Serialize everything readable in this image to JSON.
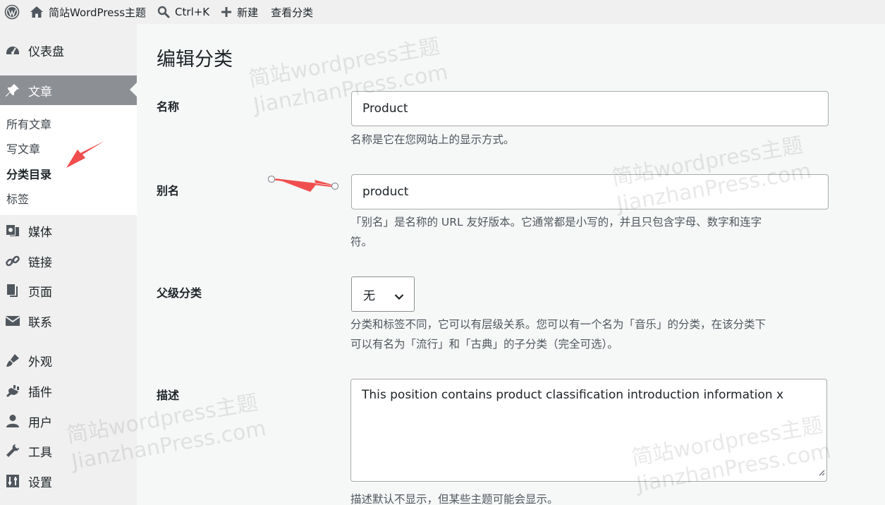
{
  "adminbar": {
    "site_name": "简站WordPress主题",
    "search_shortcut": "Ctrl+K",
    "new_label": "新建",
    "view_category": "查看分类"
  },
  "sidebar": {
    "items": [
      {
        "label": "仪表盘",
        "icon": "dashboard-icon"
      },
      {
        "label": "文章",
        "icon": "pin-icon"
      },
      {
        "label": "媒体",
        "icon": "media-icon"
      },
      {
        "label": "链接",
        "icon": "link-icon"
      },
      {
        "label": "页面",
        "icon": "page-icon"
      },
      {
        "label": "联系",
        "icon": "mail-icon"
      },
      {
        "label": "外观",
        "icon": "brush-icon"
      },
      {
        "label": "插件",
        "icon": "plugin-icon"
      },
      {
        "label": "用户",
        "icon": "user-icon"
      },
      {
        "label": "工具",
        "icon": "wrench-icon"
      },
      {
        "label": "设置",
        "icon": "settings-icon"
      }
    ],
    "submenu": [
      "所有文章",
      "写文章",
      "分类目录",
      "标签"
    ]
  },
  "main": {
    "title": "编辑分类",
    "name": {
      "label": "名称",
      "value": "Product",
      "desc": "名称是它在您网站上的显示方式。"
    },
    "slug": {
      "label": "别名",
      "value": "product",
      "desc_line1": "「别名」是名称的 URL 友好版本。它通常都是小写的，并且只包含字母、数字和连字",
      "desc_line2": "符。"
    },
    "parent": {
      "label": "父级分类",
      "selected": "无",
      "desc_line1": "分类和标签不同，它可以有层级关系。您可以有一个名为「音乐」的分类，在该分类下",
      "desc_line2": "可以有名为「流行」和「古典」的子分类（完全可选）。"
    },
    "description": {
      "label": "描述",
      "value": "This position contains product classification introduction information x",
      "desc": "描述默认不显示，但某些主题可能会显示。"
    }
  },
  "watermark": {
    "line1": "简站wordpress主题",
    "line2": "JianzhanPress.com"
  },
  "colors": {
    "current_menu_bg": "#8c8f94",
    "annotation_arrow": "#f04e4e"
  }
}
